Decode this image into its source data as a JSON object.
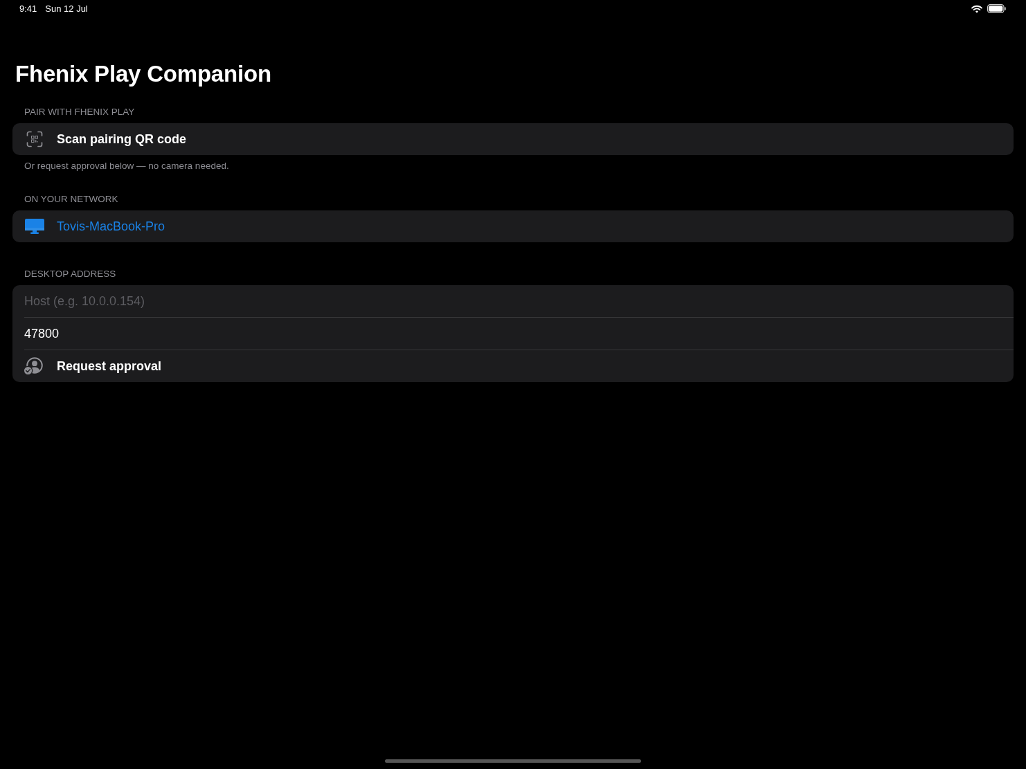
{
  "status_bar": {
    "time": "9:41",
    "date": "Sun 12 Jul"
  },
  "title": "Fhenix Play Companion",
  "sections": [
    {
      "header": "PAIR WITH FHENIX PLAY",
      "rows": [
        {
          "kind": "scan",
          "label": "Scan pairing QR code"
        }
      ],
      "footer": "Or request approval below — no camera needed."
    },
    {
      "header": "ON YOUR NETWORK",
      "rows": [
        {
          "kind": "device",
          "label": "Tovis-MacBook-Pro"
        }
      ]
    },
    {
      "header": "DESKTOP ADDRESS",
      "rows": [
        {
          "kind": "field",
          "placeholder": "Host (e.g. 10.0.0.154)"
        },
        {
          "kind": "field",
          "value": "47800"
        },
        {
          "kind": "approve",
          "label": "Request approval"
        }
      ]
    }
  ]
}
